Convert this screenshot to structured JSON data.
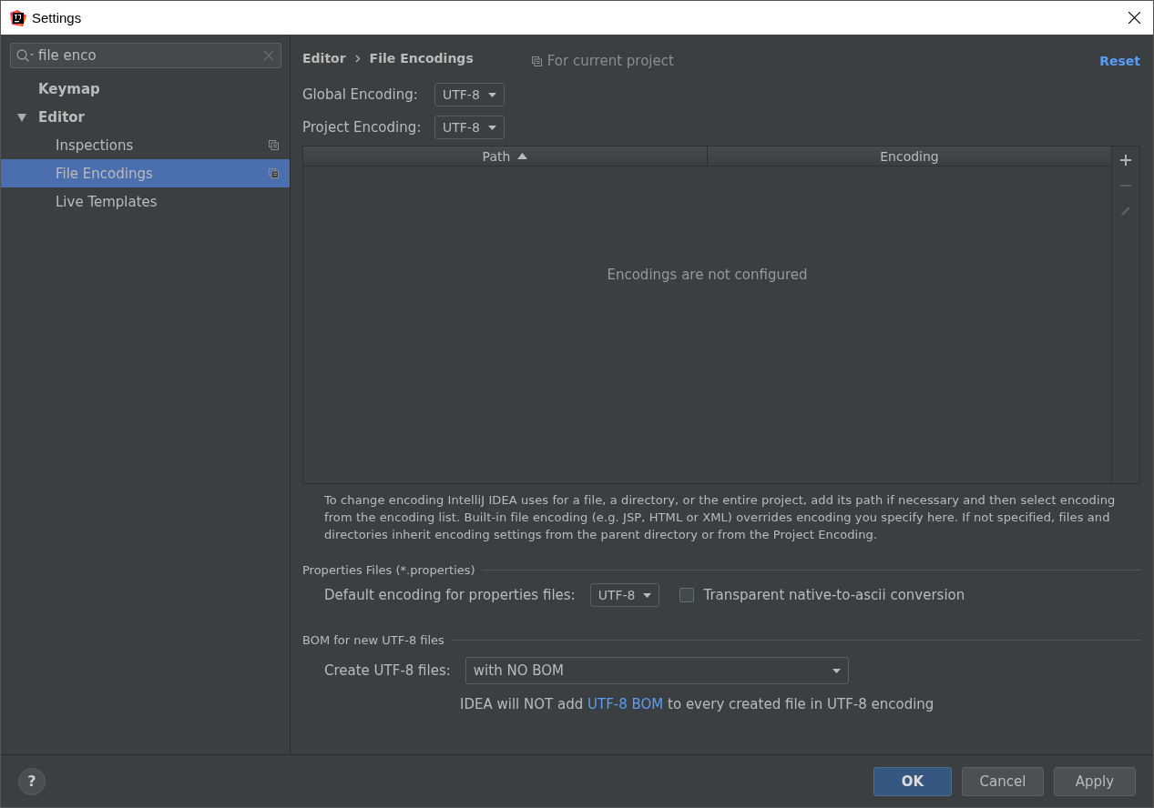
{
  "window": {
    "title": "Settings"
  },
  "search": {
    "value": "file enco"
  },
  "tree": [
    {
      "label": "Keymap",
      "selected": false,
      "project_scope": false
    },
    {
      "label": "Editor",
      "selected": false,
      "project_scope": false,
      "expanded": true,
      "children": [
        {
          "label": "Inspections",
          "selected": false,
          "project_scope": true
        },
        {
          "label": "File Encodings",
          "selected": true,
          "project_scope": true
        },
        {
          "label": "Live Templates",
          "selected": false,
          "project_scope": false
        }
      ]
    }
  ],
  "breadcrumb": [
    "Editor",
    "File Encodings"
  ],
  "scope_label": "For current project",
  "reset": "Reset",
  "global_encoding": {
    "label": "Global Encoding:",
    "value": "UTF-8"
  },
  "project_encoding": {
    "label": "Project Encoding:",
    "value": "UTF-8"
  },
  "table": {
    "columns": [
      {
        "label": "Path",
        "sorted": true
      },
      {
        "label": "Encoding",
        "sorted": false
      }
    ],
    "empty_text": "Encodings are not configured"
  },
  "toolbar": [
    {
      "kind": "add",
      "disabled": false
    },
    {
      "kind": "remove",
      "disabled": true
    },
    {
      "kind": "edit",
      "disabled": true
    }
  ],
  "hint": "To change encoding IntelliJ IDEA uses for a file, a directory, or the entire project, add its path if necessary and then select encoding from the encoding list. Built-in file encoding (e.g. JSP, HTML or XML) overrides encoding you specify here. If not specified, files and directories inherit encoding settings from the parent directory or from the Project Encoding.",
  "properties": {
    "title": "Properties Files (*.properties)",
    "label": "Default encoding for properties files:",
    "value": "UTF-8",
    "checkbox": {
      "label": "Transparent native-to-ascii conversion",
      "checked": false
    }
  },
  "bom": {
    "title": "BOM for new UTF-8 files",
    "label": "Create UTF-8 files:",
    "value": "with NO BOM",
    "note_before": "IDEA will NOT add",
    "note_link": "UTF-8 BOM",
    "note_after": "to every created file in UTF-8 encoding"
  },
  "help": "?",
  "buttons": [
    {
      "label": "OK",
      "kind": "default"
    },
    {
      "label": "Cancel",
      "kind": "normal"
    },
    {
      "label": "Apply",
      "kind": "normal"
    }
  ]
}
